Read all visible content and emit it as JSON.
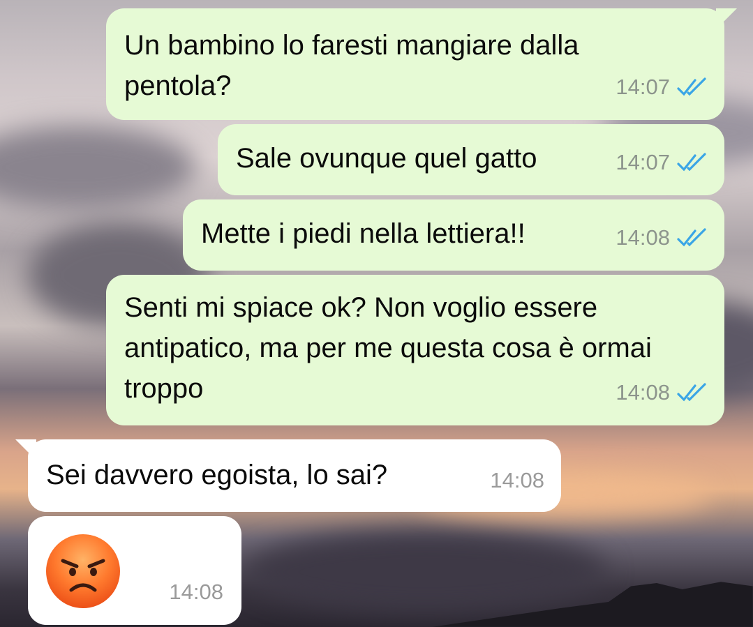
{
  "messages": [
    {
      "text": "Un bambino lo faresti mangiare dalla pentola?",
      "time": "14:07",
      "status_icon": "double-check-read-icon"
    },
    {
      "text": "Sale ovunque quel gatto",
      "time": "14:07",
      "status_icon": "double-check-read-icon"
    },
    {
      "text": "Mette i piedi nella lettiera!!",
      "time": "14:08",
      "status_icon": "double-check-read-icon"
    },
    {
      "text": "Senti mi spiace ok? Non voglio essere antipatico, ma per me questa cosa è ormai troppo",
      "time": "14:08",
      "status_icon": "double-check-read-icon"
    },
    {
      "text": "Sei davvero egoista, lo sai?",
      "time": "14:08"
    },
    {
      "emoji": "angry-face-emoji",
      "time": "14:08"
    }
  ],
  "colors": {
    "outgoing_bubble": "#e6fad5",
    "incoming_bubble": "#ffffff",
    "read_ticks": "#3aa5e6",
    "timestamp": "#8c948c"
  }
}
